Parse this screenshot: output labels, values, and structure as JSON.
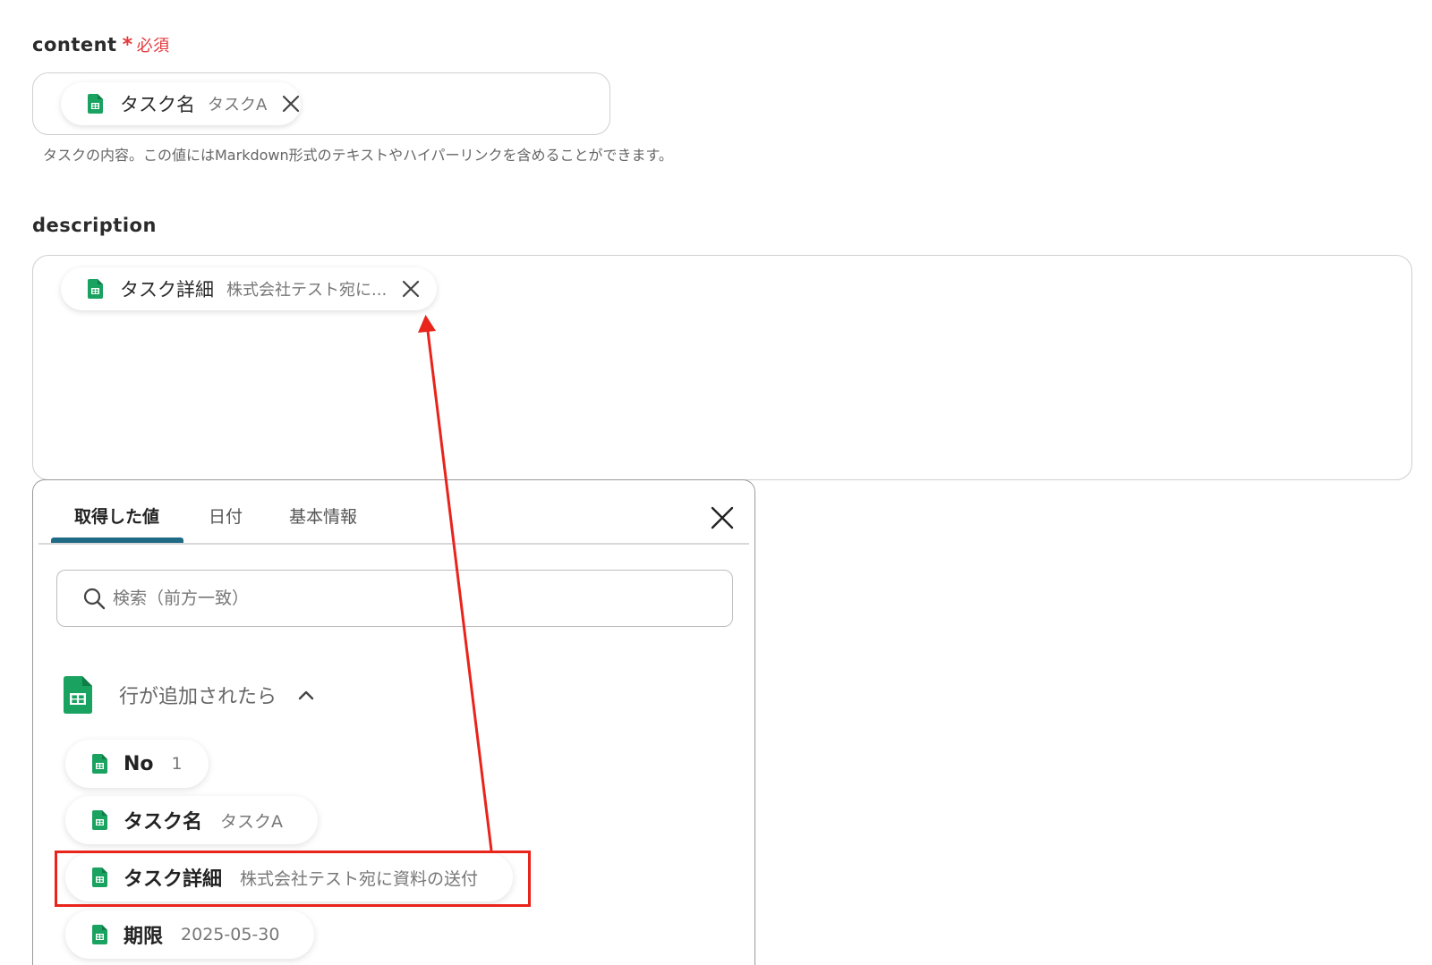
{
  "content_field": {
    "label": "content",
    "required_star": "*",
    "required_text": "必須",
    "chip": {
      "name": "タスク名",
      "value": "タスクA"
    },
    "help": "タスクの内容。この値にはMarkdown形式のテキストやハイパーリンクを含めることができます。"
  },
  "description_field": {
    "label": "description",
    "chip": {
      "name": "タスク詳細",
      "value": "株式会社テスト宛に..."
    }
  },
  "picker": {
    "tabs": [
      {
        "label": "取得した値",
        "active": true
      },
      {
        "label": "日付",
        "active": false
      },
      {
        "label": "基本情報",
        "active": false
      }
    ],
    "search_placeholder": "検索（前方一致）",
    "group": {
      "title": "行が追加されたら",
      "expanded": true,
      "items": [
        {
          "name": "No",
          "value": "1"
        },
        {
          "name": "タスク名",
          "value": "タスクA"
        },
        {
          "name": "タスク詳細",
          "value": "株式会社テスト宛に資料の送付",
          "highlighted": true
        },
        {
          "name": "期限",
          "value": "2025-05-30"
        }
      ]
    }
  },
  "colors": {
    "required": "#e5383b",
    "sheets_green": "#1aa260",
    "tab_active_underline": "#1f6b86",
    "annotation_red": "#e8241b"
  }
}
